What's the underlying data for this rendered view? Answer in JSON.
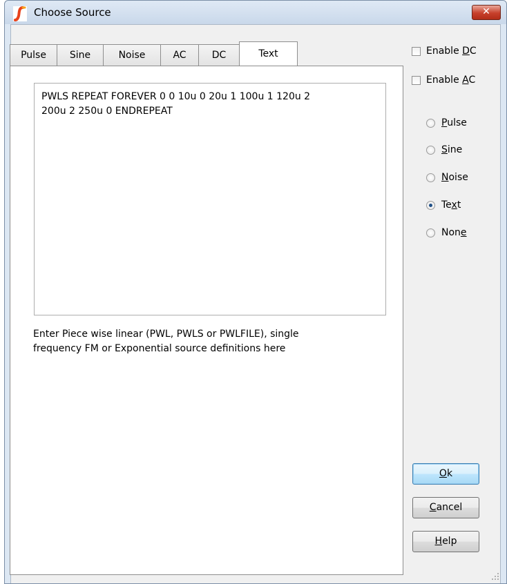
{
  "window": {
    "title": "Choose Source",
    "close_label": "✕"
  },
  "tabs": [
    {
      "label": "Pulse"
    },
    {
      "label": "Sine"
    },
    {
      "label": "Noise"
    },
    {
      "label": "AC"
    },
    {
      "label": "DC"
    },
    {
      "label": "Text",
      "active": true
    }
  ],
  "editor": {
    "value": "PWLS REPEAT FOREVER 0 0 10u 0 20u 1 100u 1 120u 2\n200u 2 250u 0 ENDREPEAT",
    "hint": "Enter Piece wise linear (PWL, PWLS or PWLFILE), single\nfrequency FM or Exponential source definitions here"
  },
  "checkboxes": {
    "enable_dc": {
      "pre": "Enable ",
      "key": "D",
      "post": "C",
      "checked": false
    },
    "enable_ac": {
      "pre": "Enable ",
      "key": "A",
      "post": "C",
      "checked": false
    }
  },
  "radios": {
    "pulse": {
      "pre": "",
      "key": "P",
      "post": "ulse",
      "selected": false
    },
    "sine": {
      "pre": "",
      "key": "S",
      "post": "ine",
      "selected": false
    },
    "noise": {
      "pre": "",
      "key": "N",
      "post": "oise",
      "selected": false
    },
    "text": {
      "pre": "Te",
      "key": "x",
      "post": "t",
      "selected": true
    },
    "none": {
      "pre": "Non",
      "key": "e",
      "post": "",
      "selected": false
    }
  },
  "buttons": {
    "ok": {
      "pre": "",
      "key": "O",
      "post": "k"
    },
    "cancel": {
      "pre": "",
      "key": "C",
      "post": "ancel"
    },
    "help": {
      "pre": "",
      "key": "H",
      "post": "elp"
    }
  },
  "colors": {
    "accent": "#3c7fb1",
    "close": "#c7402b",
    "logo": "#e8421b"
  }
}
